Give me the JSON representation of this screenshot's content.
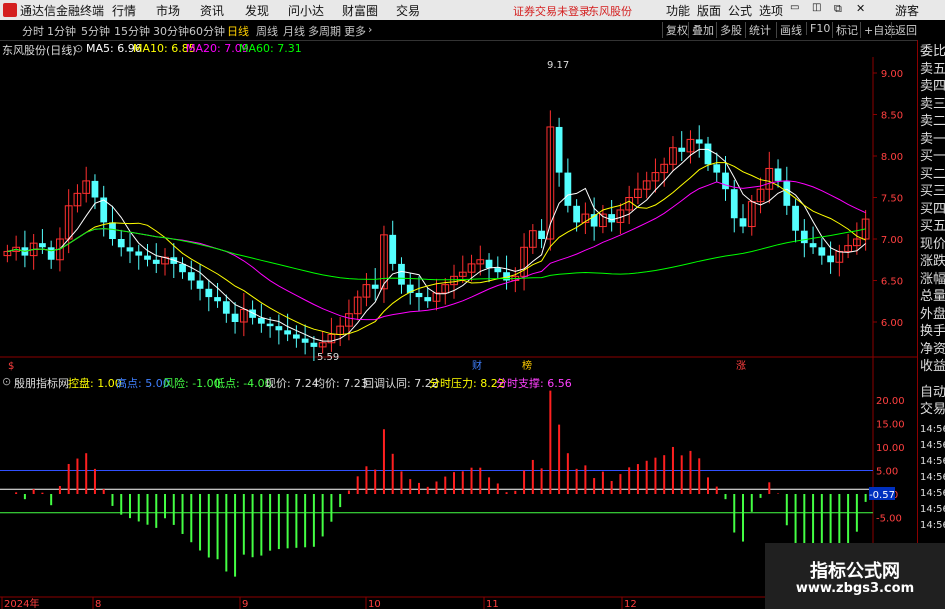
{
  "titlebar": {
    "app_name": "通达信金融终端",
    "menu": [
      "行情",
      "市场",
      "资讯",
      "发现",
      "问小达",
      "财富圈",
      "交易"
    ],
    "warning": "证券交易未登录",
    "stock_name": "东风股份",
    "right_menu": [
      "功能",
      "版面",
      "公式",
      "选项"
    ],
    "guest": "游客"
  },
  "toolbar": {
    "periods": [
      "分时",
      "1分钟",
      "5分钟",
      "15分钟",
      "30分钟",
      "60分钟",
      "日线",
      "周线",
      "月线",
      "多周期",
      "更多"
    ],
    "active_period": "日线",
    "right_buttons": [
      "复权",
      "叠加",
      "多股",
      "统计",
      "画线",
      "F10",
      "标记",
      "+自选",
      "返回"
    ]
  },
  "info": {
    "title": "东风股份(日线)",
    "ma5": "MA5: 6.96",
    "ma10": "MA10: 6.85",
    "ma20": "MA20: 7.09",
    "ma60": "MA60: 7.31"
  },
  "price_axis": [
    "9.00",
    "8.50",
    "8.00",
    "7.50",
    "7.00",
    "6.50",
    "6.00"
  ],
  "annotations": {
    "high": "9.17",
    "low": "5.59"
  },
  "event_markers": [
    "$",
    "财",
    "榜",
    "涨"
  ],
  "indicator": {
    "name": "殷朋指标网",
    "kongpan": "控盘: 1.00",
    "gaodian": "高点: 5.00",
    "fengxian": "风险: -1.00",
    "didian": "低点: -4.00",
    "xianjia": "现价: 7.24",
    "junjia": "均价: 7.23",
    "huitiao": "回调认同: 7.22",
    "fenshi_yali": "分时压力: 8.22",
    "fenshi_zhicheng": "分时支撑: 6.56",
    "axis": [
      "20.00",
      "15.00",
      "10.00",
      "5.00",
      "0.00",
      "-5.00"
    ],
    "current_value": "-0.57"
  },
  "time_axis": [
    "2024年",
    "8",
    "9",
    "10",
    "11",
    "12"
  ],
  "right_panel": {
    "top_labels": [
      "委比",
      "卖五",
      "卖四",
      "卖三",
      "卖二",
      "卖一",
      "买一",
      "买二",
      "买三",
      "买四",
      "买五",
      "现价",
      "涨跌",
      "涨幅",
      "总量",
      "外盘",
      "换手",
      "净资",
      "收益"
    ],
    "mid_labels": [
      "自动",
      "交易"
    ],
    "times": [
      "14:56",
      "14:56",
      "14:56",
      "14:56",
      "14:56",
      "14:56",
      "14:56"
    ]
  },
  "colors": {
    "up": "#ff3030",
    "down": "#54ffff",
    "ma5": "#ffffff",
    "ma10": "#ffff00",
    "ma20": "#ff00ff",
    "ma60": "#00ff00",
    "ind_up": "#ff2020",
    "ind_down": "#44ff44"
  },
  "watermark": {
    "line1": "指标公式网",
    "line2": "www.zbgs3.com"
  }
}
